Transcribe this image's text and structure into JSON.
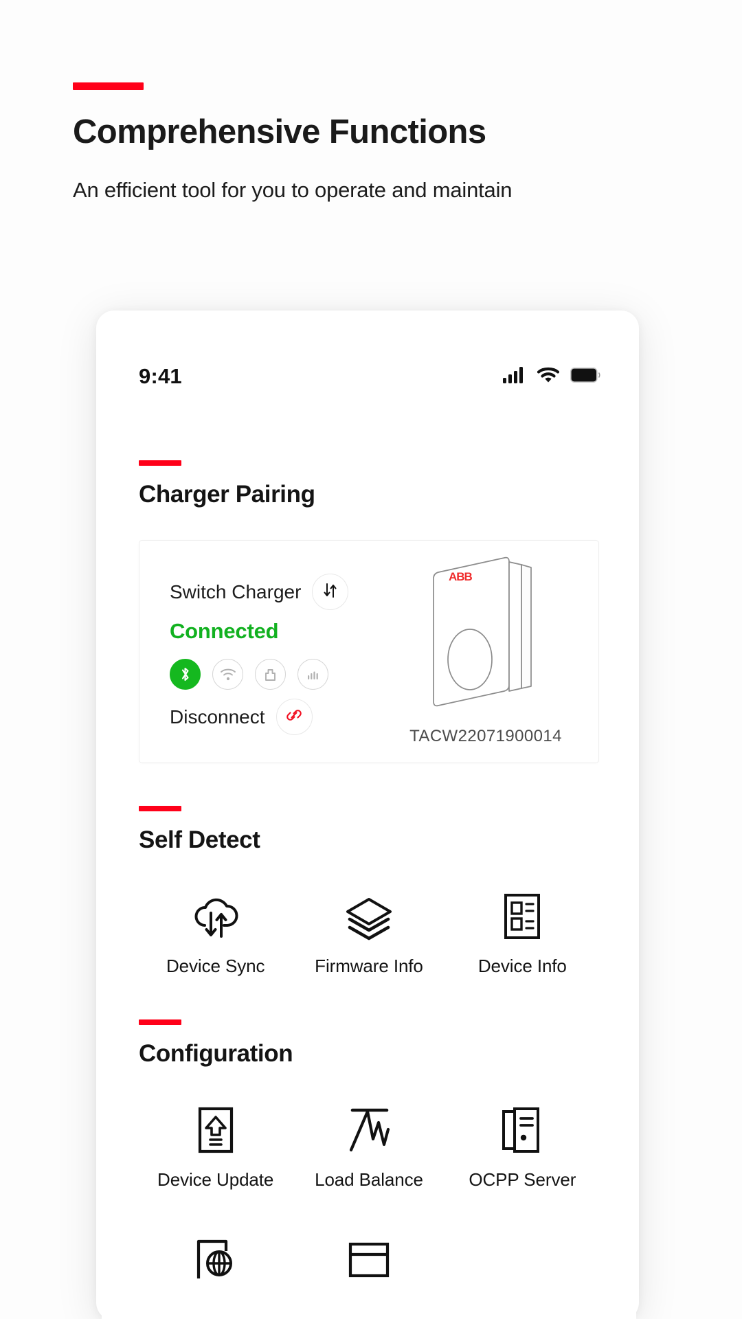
{
  "hero": {
    "title": "Comprehensive Functions",
    "subtitle": "An efficient tool for you to operate and maintain",
    "accent_color": "#ff0019"
  },
  "phone": {
    "status_bar": {
      "time": "9:41",
      "icons": [
        "cellular-signal-icon",
        "wifi-icon",
        "battery-icon"
      ]
    },
    "sections": [
      {
        "id": "charger-pairing",
        "title": "Charger Pairing",
        "card": {
          "switch_charger_label": "Switch Charger",
          "switch_charger_icon": "swap-arrows-icon",
          "status_label": "Connected",
          "status_color": "#12b120",
          "connection_icons": [
            {
              "name": "bluetooth-icon",
              "active": true
            },
            {
              "name": "wifi-icon",
              "active": false
            },
            {
              "name": "ethernet-icon",
              "active": false
            },
            {
              "name": "cellular-icon",
              "active": false
            }
          ],
          "disconnect_label": "Disconnect",
          "disconnect_icon": "broken-link-icon",
          "device_brand": "ABB",
          "device_serial": "TACW22071900014"
        }
      },
      {
        "id": "self-detect",
        "title": "Self Detect",
        "items": [
          {
            "label": "Device Sync",
            "icon": "cloud-sync-icon"
          },
          {
            "label": "Firmware Info",
            "icon": "layers-icon"
          },
          {
            "label": "Device Info",
            "icon": "device-document-icon"
          }
        ]
      },
      {
        "id": "configuration",
        "title": "Configuration",
        "items": [
          {
            "label": "Device Update",
            "icon": "file-upload-icon"
          },
          {
            "label": "Load Balance",
            "icon": "load-chart-icon"
          },
          {
            "label": "OCPP Server",
            "icon": "server-icon"
          },
          {
            "label": "",
            "icon": "network-globe-icon"
          },
          {
            "label": "",
            "icon": "card-icon"
          },
          {
            "label": "",
            "icon": ""
          }
        ]
      }
    ]
  }
}
